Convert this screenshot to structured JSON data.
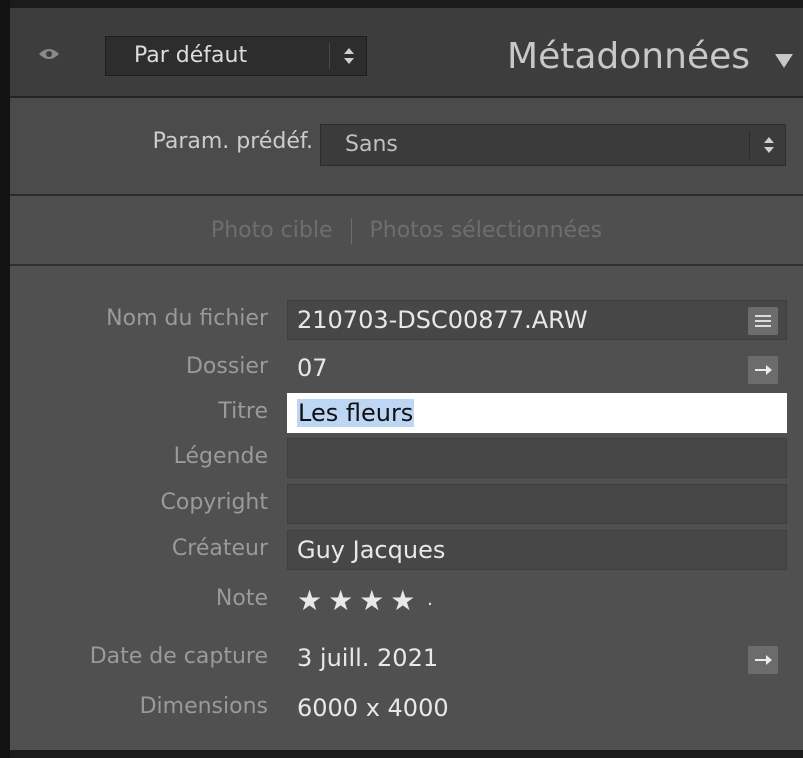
{
  "header": {
    "preset_label": "Par défaut",
    "panel_title": "Métadonnées"
  },
  "preset_row": {
    "label": "Param. prédéf.",
    "value": "Sans"
  },
  "mode": {
    "target": "Photo cible",
    "selected": "Photos sélectionnées"
  },
  "fields": {
    "filename": {
      "label": "Nom du fichier",
      "value": "210703-DSC00877.ARW"
    },
    "folder": {
      "label": "Dossier",
      "value": "07"
    },
    "title": {
      "label": "Titre",
      "value": "Les fleurs"
    },
    "caption": {
      "label": "Légende",
      "value": ""
    },
    "copyright": {
      "label": "Copyright",
      "value": ""
    },
    "creator": {
      "label": "Créateur",
      "value": "Guy Jacques"
    },
    "rating": {
      "label": "Note",
      "value": 4,
      "max": 5,
      "display": "★★★★"
    },
    "capture_date": {
      "label": "Date de capture",
      "value": "3 juill. 2021"
    },
    "dimensions": {
      "label": "Dimensions",
      "value": "6000 x 4000"
    }
  },
  "colors": {
    "panel_bg": "#505050",
    "header_bg": "#3d3d3d",
    "active_field_bg": "#ffffff",
    "selection_highlight": "#bcd6f4"
  },
  "icons": [
    "eye-icon",
    "up-down-arrows-icon",
    "triangle-down-icon",
    "list-icon",
    "arrow-right-icon"
  ]
}
